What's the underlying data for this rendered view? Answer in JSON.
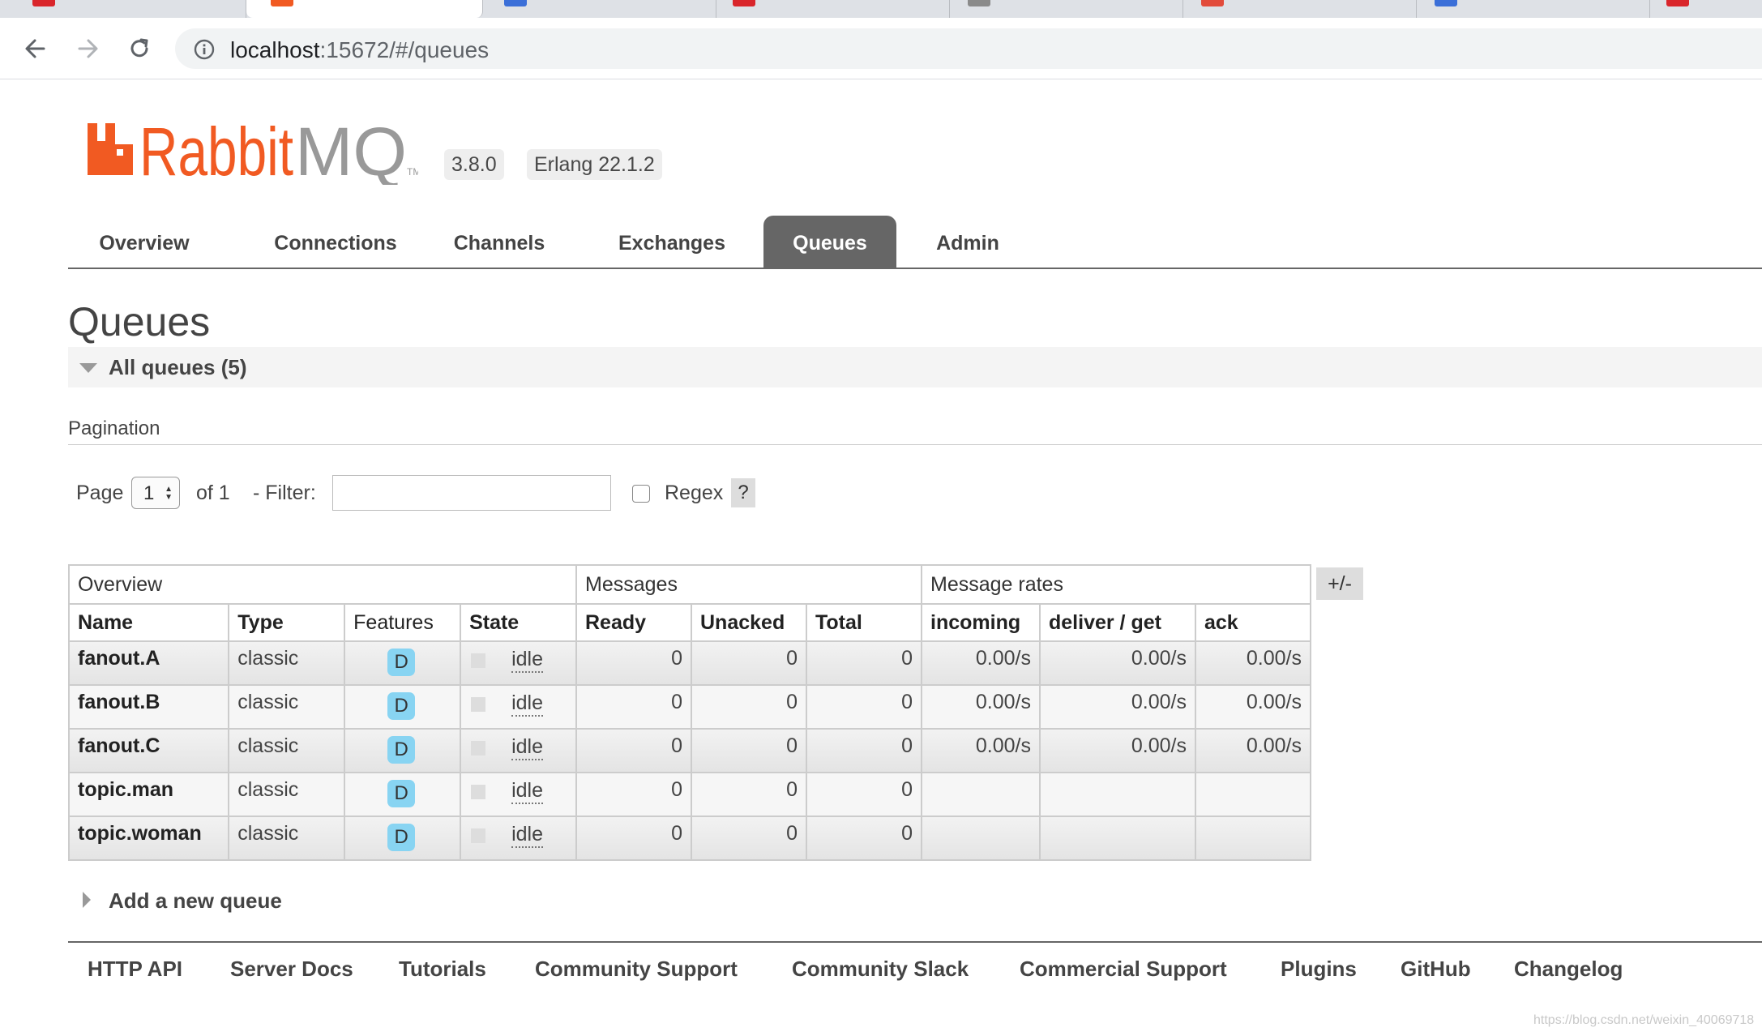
{
  "browser": {
    "url_host": "localhost",
    "url_rest": ":15672/#/queues"
  },
  "header": {
    "logo_text": "RabbitMQ",
    "version": "3.8.0",
    "erlang": "Erlang 22.1.2"
  },
  "nav": {
    "items": [
      "Overview",
      "Connections",
      "Channels",
      "Exchanges",
      "Queues",
      "Admin"
    ],
    "active": "Queues"
  },
  "page": {
    "title": "Queues",
    "section": "All queues (5)"
  },
  "pagination": {
    "title": "Pagination",
    "page_label": "Page",
    "page_value": "1",
    "of_label": "of 1",
    "filter_label": "- Filter:",
    "filter_value": "",
    "regex_label": "Regex",
    "help": "?"
  },
  "table": {
    "groups": [
      "Overview",
      "Messages",
      "Message rates"
    ],
    "columns": [
      "Name",
      "Type",
      "Features",
      "State",
      "Ready",
      "Unacked",
      "Total",
      "incoming",
      "deliver / get",
      "ack"
    ],
    "toggle": "+/-",
    "rows": [
      {
        "name": "fanout.A",
        "type": "classic",
        "feature": "D",
        "state": "idle",
        "ready": "0",
        "unacked": "0",
        "total": "0",
        "incoming": "0.00/s",
        "deliver": "0.00/s",
        "ack": "0.00/s"
      },
      {
        "name": "fanout.B",
        "type": "classic",
        "feature": "D",
        "state": "idle",
        "ready": "0",
        "unacked": "0",
        "total": "0",
        "incoming": "0.00/s",
        "deliver": "0.00/s",
        "ack": "0.00/s"
      },
      {
        "name": "fanout.C",
        "type": "classic",
        "feature": "D",
        "state": "idle",
        "ready": "0",
        "unacked": "0",
        "total": "0",
        "incoming": "0.00/s",
        "deliver": "0.00/s",
        "ack": "0.00/s"
      },
      {
        "name": "topic.man",
        "type": "classic",
        "feature": "D",
        "state": "idle",
        "ready": "0",
        "unacked": "0",
        "total": "0",
        "incoming": "",
        "deliver": "",
        "ack": ""
      },
      {
        "name": "topic.woman",
        "type": "classic",
        "feature": "D",
        "state": "idle",
        "ready": "0",
        "unacked": "0",
        "total": "0",
        "incoming": "",
        "deliver": "",
        "ack": ""
      }
    ]
  },
  "add_queue": "Add a new queue",
  "footer": {
    "links": [
      "HTTP API",
      "Server Docs",
      "Tutorials",
      "Community Support",
      "Community Slack",
      "Commercial Support",
      "Plugins",
      "GitHub",
      "Changelog"
    ]
  },
  "watermark": "https://blog.csdn.net/weixin_40069718",
  "colors": {
    "brand_orange": "#f15a22",
    "nav_active": "#666666",
    "feature_badge": "#88d4f2"
  }
}
